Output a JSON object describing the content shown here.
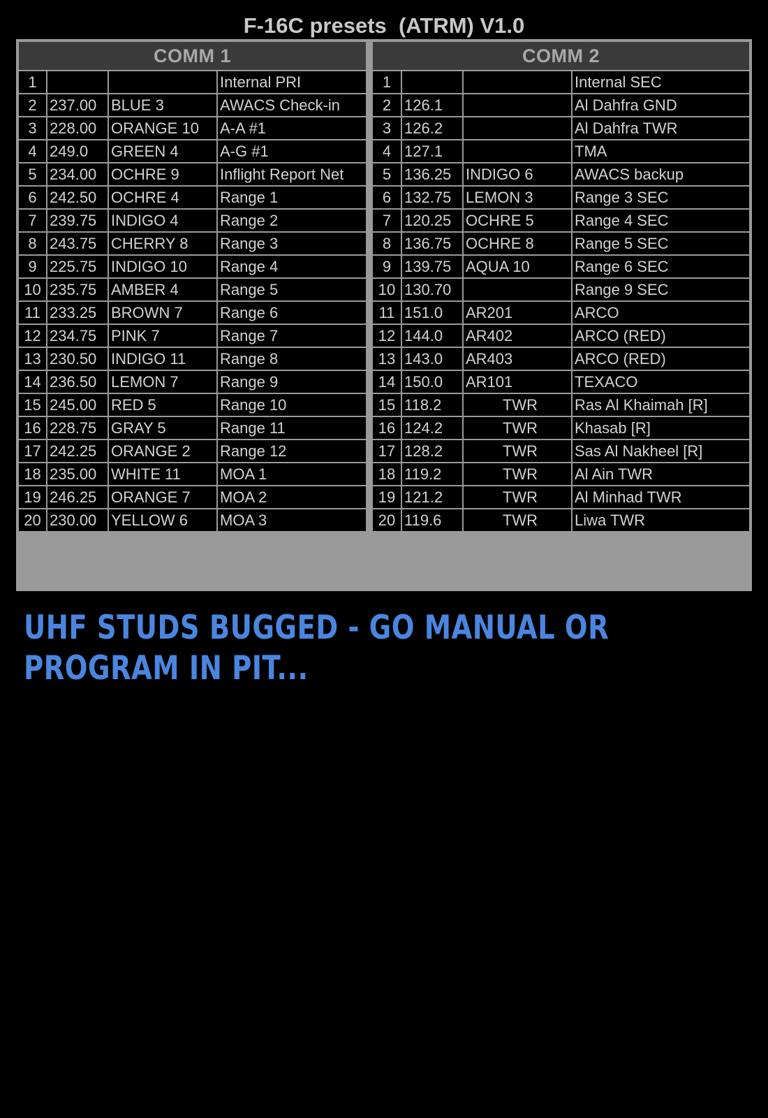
{
  "title": "F-16C presets  (ATRM) V1.0",
  "comm1": {
    "header": "COMM 1",
    "rows": [
      [
        "1",
        "",
        "",
        "Internal PRI"
      ],
      [
        "2",
        "237.00",
        "BLUE 3",
        "AWACS Check-in"
      ],
      [
        "3",
        "228.00",
        "ORANGE 10",
        "A-A #1"
      ],
      [
        "4",
        "249.0",
        "GREEN 4",
        "A-G #1"
      ],
      [
        "5",
        "234.00",
        "OCHRE 9",
        "Inflight Report Net"
      ],
      [
        "6",
        "242.50",
        "OCHRE 4",
        "Range 1"
      ],
      [
        "7",
        "239.75",
        "INDIGO 4",
        "Range 2"
      ],
      [
        "8",
        "243.75",
        "CHERRY 8",
        "Range 3"
      ],
      [
        "9",
        "225.75",
        "INDIGO 10",
        "Range 4"
      ],
      [
        "10",
        "235.75",
        "AMBER 4",
        "Range 5"
      ],
      [
        "11",
        "233.25",
        "BROWN 7",
        "Range 6"
      ],
      [
        "12",
        "234.75",
        "PINK 7",
        "Range 7"
      ],
      [
        "13",
        "230.50",
        "INDIGO 11",
        "Range 8"
      ],
      [
        "14",
        "236.50",
        "LEMON 7",
        "Range 9"
      ],
      [
        "15",
        "245.00",
        "RED 5",
        "Range 10"
      ],
      [
        "16",
        "228.75",
        "GRAY 5",
        "Range 11"
      ],
      [
        "17",
        "242.25",
        "ORANGE 2",
        "Range 12"
      ],
      [
        "18",
        "235.00",
        "WHITE 11",
        "MOA 1"
      ],
      [
        "19",
        "246.25",
        "ORANGE 7",
        "MOA 2"
      ],
      [
        "20",
        "230.00",
        "YELLOW 6",
        "MOA 3"
      ]
    ]
  },
  "comm2": {
    "header": "COMM 2",
    "rows": [
      [
        "1",
        "",
        "",
        "Internal SEC"
      ],
      [
        "2",
        "126.1",
        "",
        "Al Dahfra GND"
      ],
      [
        "3",
        "126.2",
        "",
        "Al Dahfra TWR"
      ],
      [
        "4",
        "127.1",
        "",
        "TMA"
      ],
      [
        "5",
        "136.25",
        "INDIGO 6",
        "AWACS backup"
      ],
      [
        "6",
        "132.75",
        "LEMON 3",
        "Range 3 SEC"
      ],
      [
        "7",
        "120.25",
        "OCHRE 5",
        "Range 4 SEC"
      ],
      [
        "8",
        "136.75",
        "OCHRE 8",
        "Range 5 SEC"
      ],
      [
        "9",
        "139.75",
        "AQUA 10",
        "Range 6 SEC"
      ],
      [
        "10",
        "130.70",
        "",
        "Range 9 SEC"
      ],
      [
        "11",
        "151.0",
        "AR201",
        "ARCO"
      ],
      [
        "12",
        "144.0",
        "AR402",
        "ARCO (RED)"
      ],
      [
        "13",
        "143.0",
        "AR403",
        "ARCO (RED)"
      ],
      [
        "14",
        "150.0",
        "AR101",
        "TEXACO"
      ],
      [
        "15",
        "118.2",
        "TWR",
        "Ras Al Khaimah [R]"
      ],
      [
        "16",
        "124.2",
        "TWR",
        "Khasab [R]"
      ],
      [
        "17",
        "128.2",
        "TWR",
        "Sas Al Nakheel [R]"
      ],
      [
        "18",
        "119.2",
        "TWR",
        "Al Ain TWR"
      ],
      [
        "19",
        "121.2",
        "TWR",
        "Al Minhad TWR"
      ],
      [
        "20",
        "119.6",
        "TWR",
        "Liwa TWR"
      ]
    ]
  },
  "warning": {
    "line1": "UHF STUDS BUGGED - GO MANUAL OR",
    "line2": "PROGRAM IN PIT..."
  },
  "colors": {
    "background": "#000000",
    "grid_lines": "#9a9a9a",
    "header_fill": "#3a3a3a",
    "cell_text": "#d2d2d2",
    "warning_text": "#4a86e0"
  }
}
